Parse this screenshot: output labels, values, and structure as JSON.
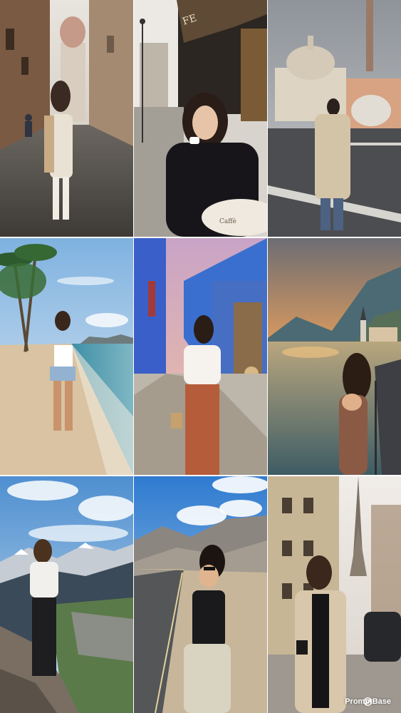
{
  "sign_text": "FE",
  "table_text": "Caffè",
  "watermark": {
    "label": "PromptBase",
    "icon": "promptbase-logo-icon"
  },
  "colors": {
    "sky_blue": "#7fb2e0",
    "sunset": "#f3a45a",
    "sea": "#3f8fa6",
    "blue_wall": "#3b5fc9",
    "coat_beige": "#d9c7ab"
  }
}
